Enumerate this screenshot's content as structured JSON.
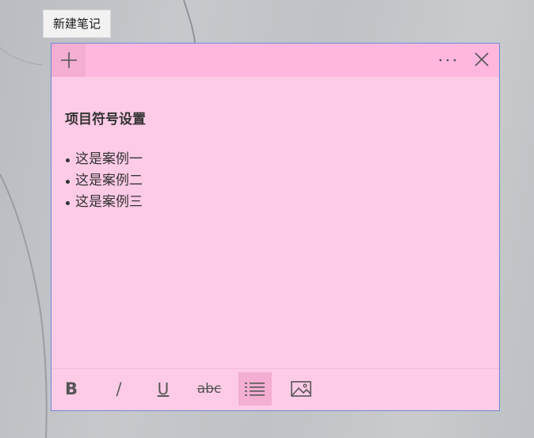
{
  "tooltip": {
    "text": "新建笔记"
  },
  "note": {
    "color": "#fecbe6",
    "titlebar_color": "#ffb7de",
    "icons": {
      "add": "plus-icon",
      "more": "more-horizontal-icon",
      "close": "close-icon"
    },
    "heading": "项目符号设置",
    "bullets": [
      "这是案例一",
      "这是案例二",
      "这是案例三"
    ],
    "toolbar": {
      "bold": "B",
      "italic": "/",
      "underline": "U",
      "strikethrough": "abc",
      "list_icon": "bullet-list-icon",
      "image_icon": "image-icon",
      "list_active": true
    }
  }
}
